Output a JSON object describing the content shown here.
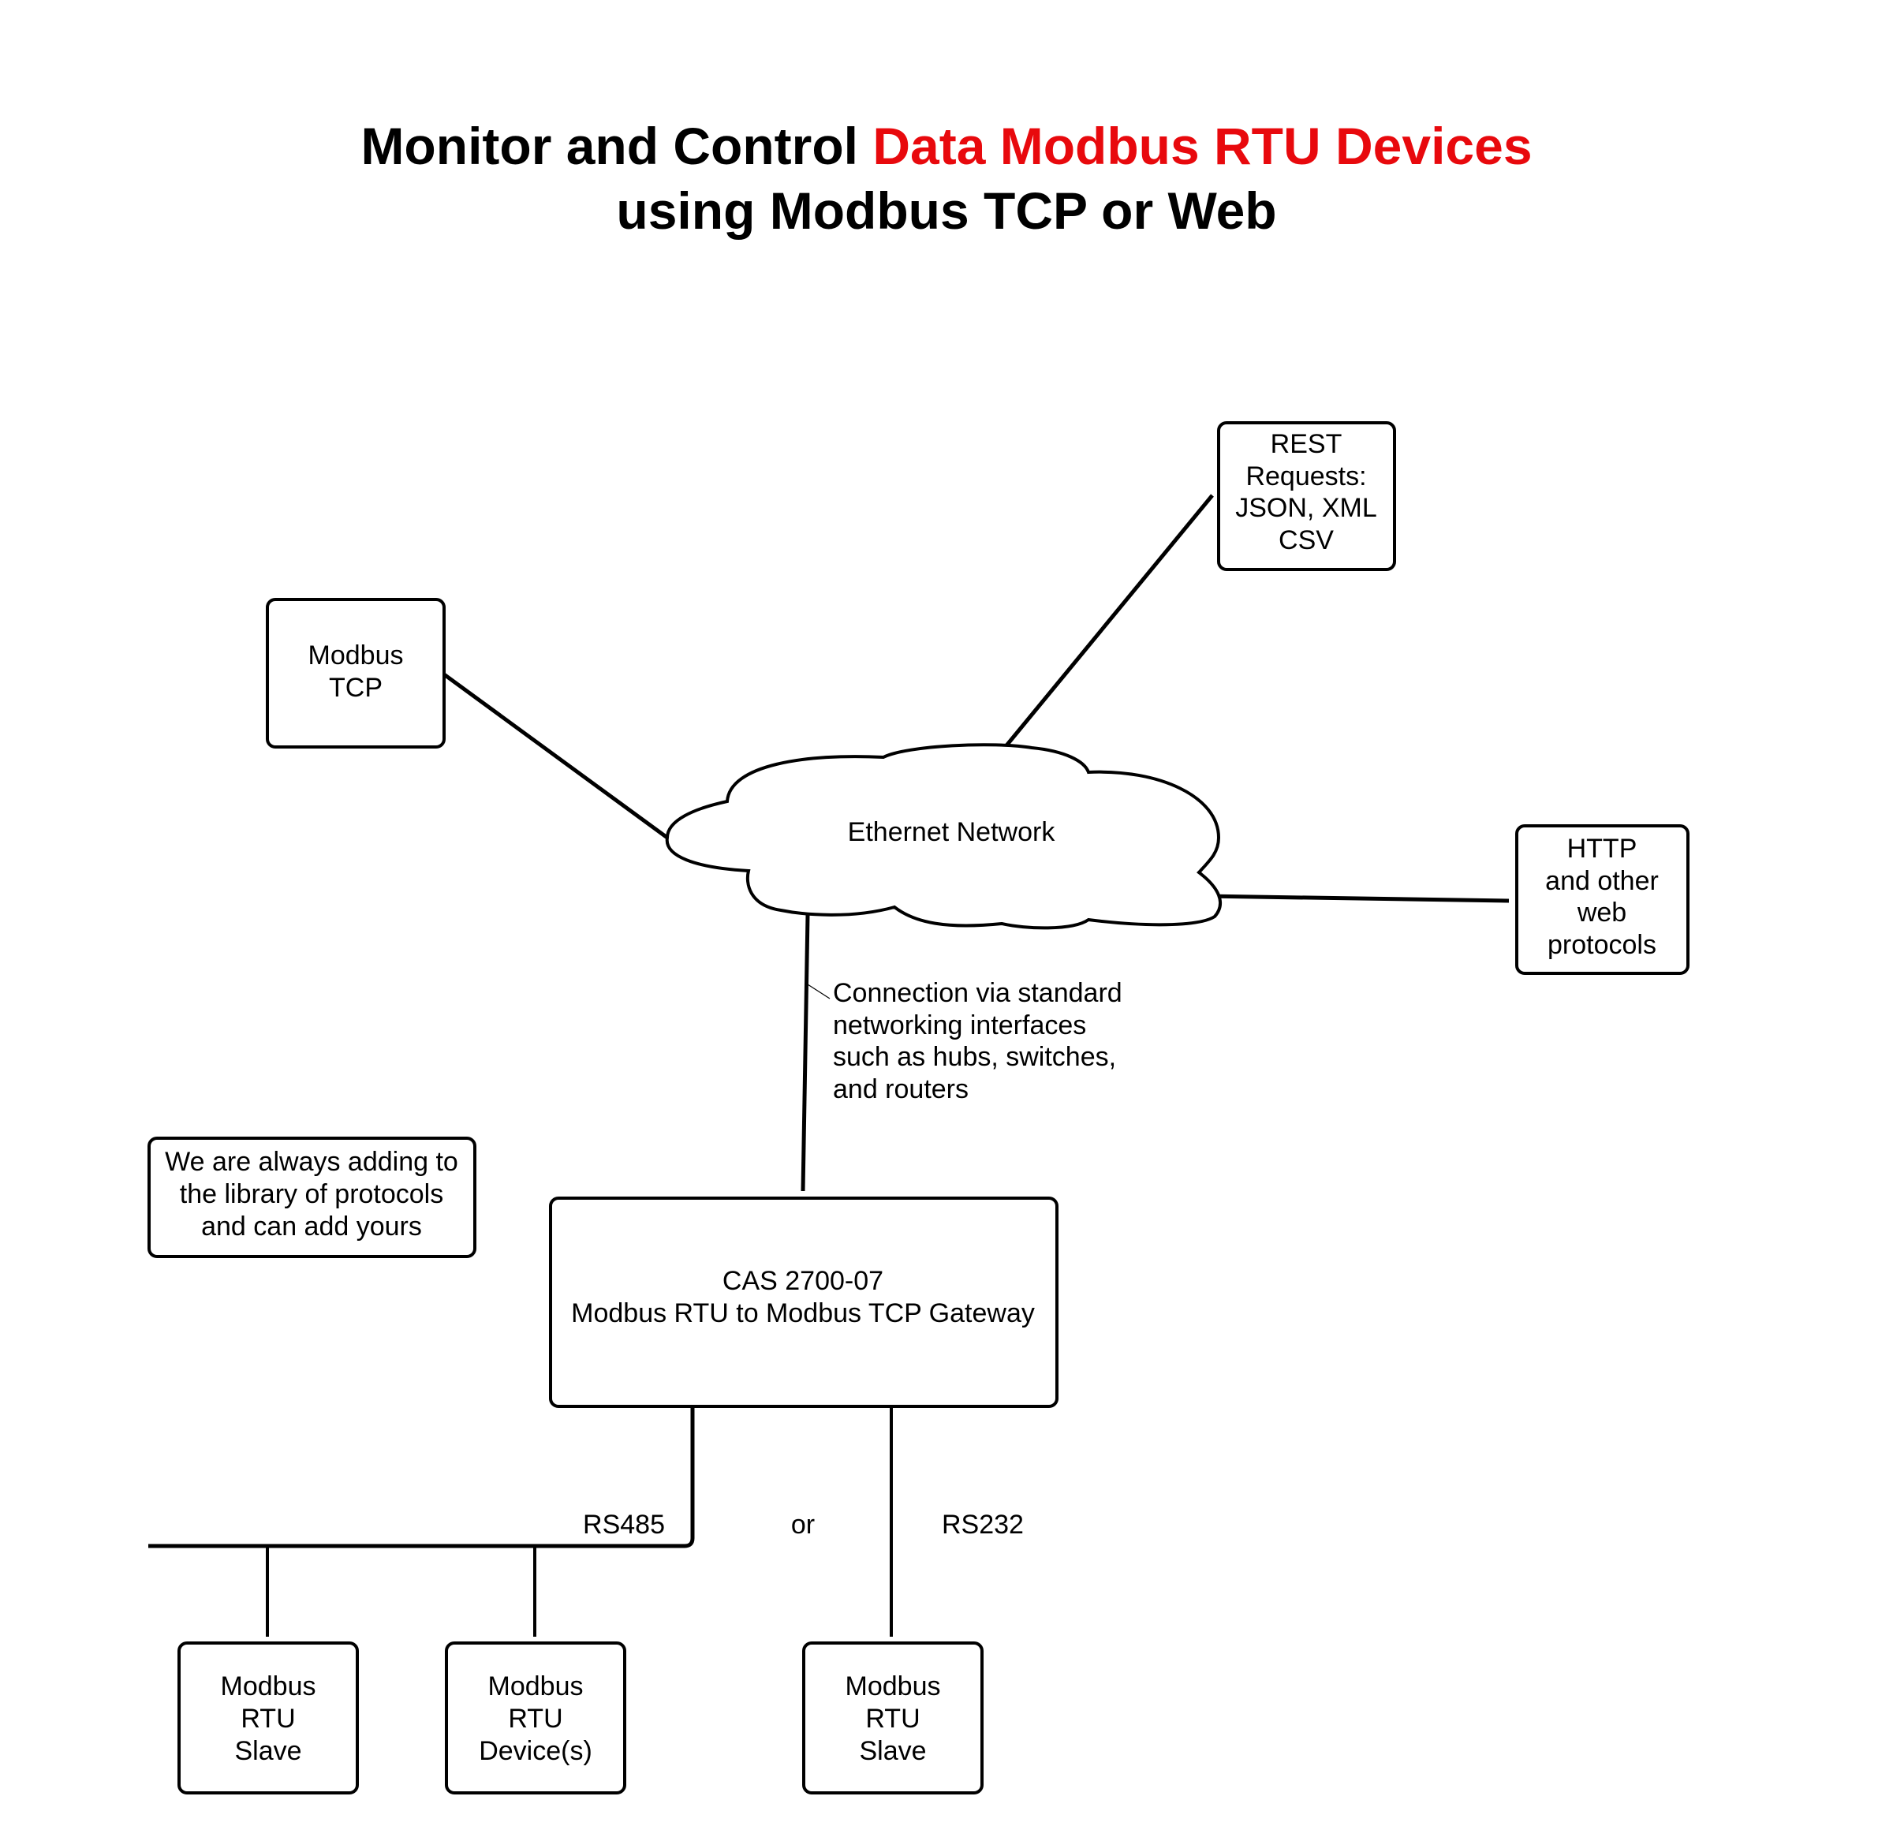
{
  "title": {
    "line1_black": "Monitor and Control ",
    "line1_red": "Data Modbus RTU Devices",
    "line2": "using Modbus TCP or Web",
    "accent_color": "#e8090d"
  },
  "nodes": {
    "modbus_tcp": {
      "lines": [
        "Modbus",
        "TCP"
      ]
    },
    "rest": {
      "lines": [
        "REST",
        "Requests:",
        "JSON, XML",
        "CSV"
      ]
    },
    "cloud": {
      "label": "Ethernet Network"
    },
    "http": {
      "lines": [
        "HTTP",
        "and other",
        "web",
        "protocols"
      ]
    },
    "gateway": {
      "lines": [
        "CAS 2700-07",
        "Modbus RTU to Modbus TCP Gateway"
      ]
    },
    "note": {
      "lines": [
        "We are always adding to",
        "the library of protocols",
        "and can add yours"
      ]
    },
    "slave_1": {
      "lines": [
        "Modbus",
        "RTU",
        "Slave"
      ]
    },
    "device": {
      "lines": [
        "Modbus",
        "RTU",
        "Device(s)"
      ]
    },
    "slave_2": {
      "lines": [
        "Modbus",
        "RTU",
        "Slave"
      ]
    }
  },
  "annotation": {
    "lines": [
      "Connection via standard",
      "networking interfaces",
      "such as hubs, switches,",
      "and routers"
    ]
  },
  "links": {
    "rs485": "RS485",
    "or": "or",
    "rs232": "RS232"
  }
}
